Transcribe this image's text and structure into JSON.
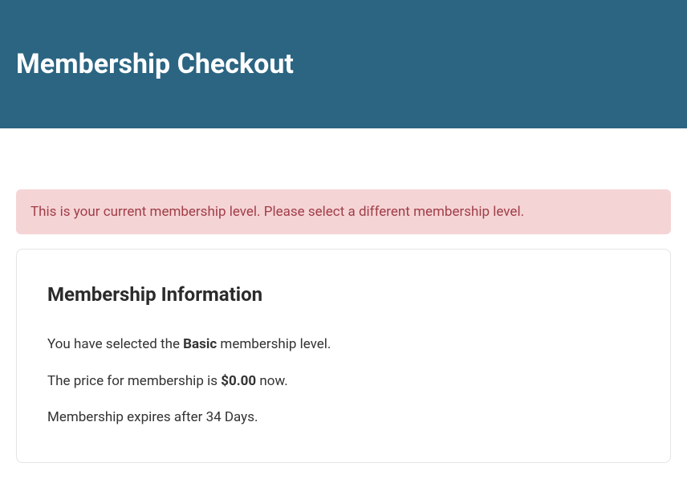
{
  "header": {
    "title": "Membership Checkout"
  },
  "alert": {
    "message": "This is your current membership level. Please select a different membership level."
  },
  "membership": {
    "section_title": "Membership Information",
    "selected_prefix": "You have selected the ",
    "level_name": "Basic",
    "selected_suffix": " membership level.",
    "price_prefix": "The price for membership is ",
    "price_value": "$0.00",
    "price_suffix": " now.",
    "expiry_text": "Membership expires after 34 Days."
  }
}
